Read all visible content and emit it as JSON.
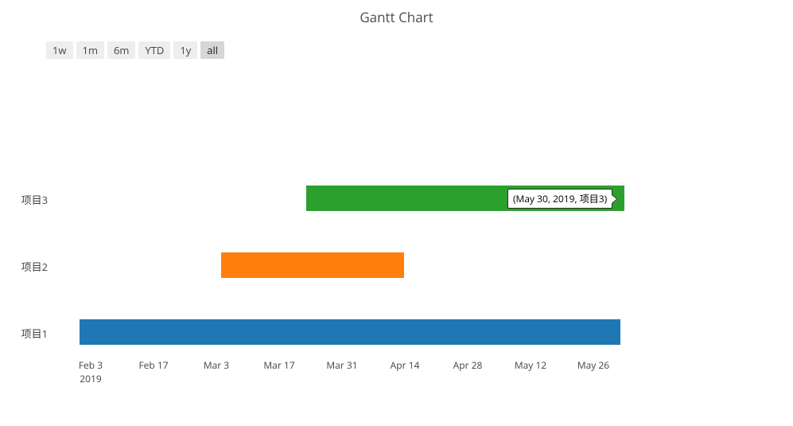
{
  "title": "Gantt Chart",
  "range_buttons": [
    {
      "label": "1w",
      "active": false
    },
    {
      "label": "1m",
      "active": false
    },
    {
      "label": "6m",
      "active": false
    },
    {
      "label": "YTD",
      "active": false
    },
    {
      "label": "1y",
      "active": false
    },
    {
      "label": "all",
      "active": true
    }
  ],
  "y_labels": [
    "项目3",
    "项目2",
    "项目1"
  ],
  "x_ticks": [
    "Feb 3",
    "Feb 17",
    "Mar 3",
    "Mar 17",
    "Mar 31",
    "Apr 14",
    "Apr 28",
    "May 12",
    "May 26"
  ],
  "x_year": "2019",
  "tooltip_text": "(May 30, 2019, 项目3)",
  "chart_data": {
    "type": "bar",
    "orientation": "horizontal",
    "title": "Gantt Chart",
    "xlabel": "",
    "ylabel": "",
    "x_type": "date",
    "x_range": [
      "2019-01-27",
      "2019-06-05"
    ],
    "series": [
      {
        "name": "项目1",
        "start": "2019-02-01",
        "end": "2019-05-20",
        "color": "#1f77b4"
      },
      {
        "name": "项目2",
        "start": "2019-03-01",
        "end": "2019-04-15",
        "color": "#ff7f0e"
      },
      {
        "name": "项目3",
        "start": "2019-03-20",
        "end": "2019-05-30",
        "color": "#2ca02c"
      }
    ],
    "highlight": {
      "series": "项目3",
      "date": "2019-05-30",
      "label": "(May 30, 2019, 项目3)"
    }
  }
}
